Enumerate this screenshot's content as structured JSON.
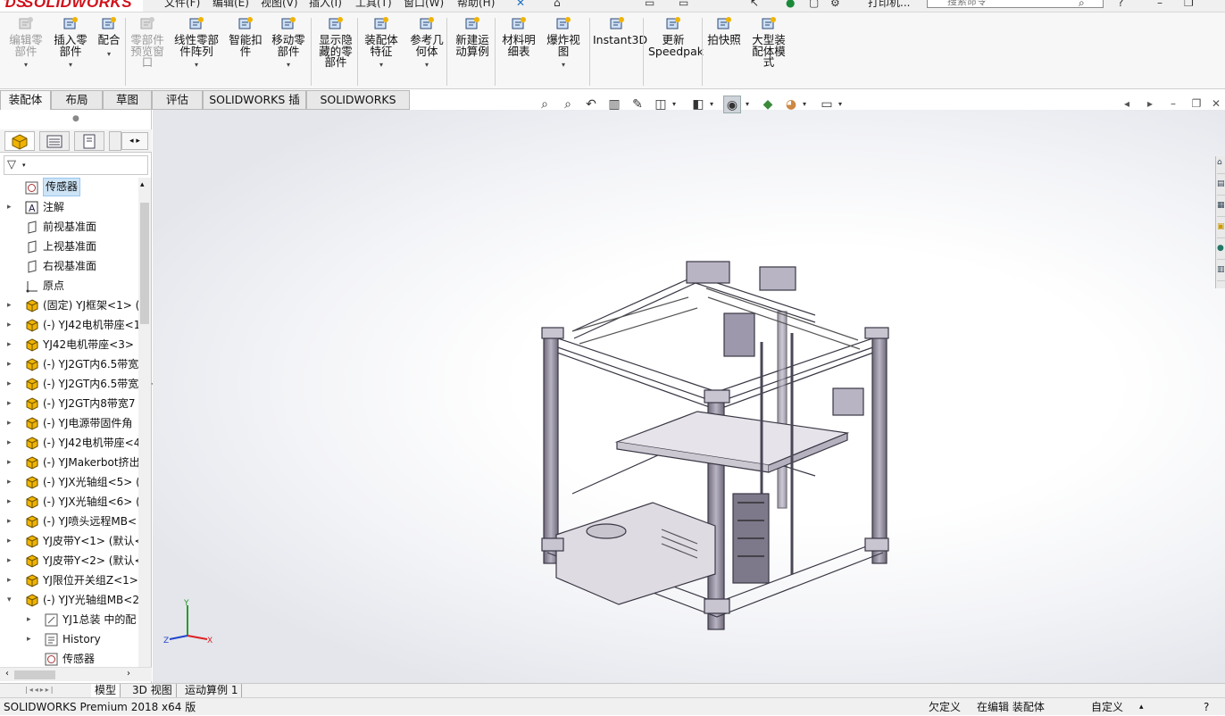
{
  "app": {
    "logo": "SOLIDWORKS",
    "menus": [
      "文件(F)",
      "编辑(E)",
      "视图(V)",
      "插入(I)",
      "工具(T)",
      "窗口(W)",
      "帮助(H)"
    ],
    "doc_title": "打印机...",
    "search_placeholder": "搜索命令"
  },
  "ribbon": {
    "buttons": [
      {
        "label": "编辑零\n部件",
        "icon": "edit-component-icon",
        "disabled": true
      },
      {
        "label": "插入零\n部件",
        "icon": "insert-component-icon",
        "disabled": false
      },
      {
        "label": "配合",
        "icon": "mate-icon",
        "disabled": false
      },
      {
        "label": "零部件\n预览窗\n口",
        "icon": "component-preview-icon",
        "disabled": true
      },
      {
        "label": "线性零部\n件阵列",
        "icon": "linear-pattern-icon",
        "disabled": false
      },
      {
        "label": "智能扣\n件",
        "icon": "smart-fasteners-icon",
        "disabled": false
      },
      {
        "label": "移动零\n部件",
        "icon": "move-component-icon",
        "disabled": false
      },
      {
        "label": "显示隐\n藏的零\n部件",
        "icon": "show-hidden-icon",
        "disabled": false
      },
      {
        "label": "装配体\n特征",
        "icon": "assembly-features-icon",
        "disabled": false
      },
      {
        "label": "参考几\n何体",
        "icon": "reference-geometry-icon",
        "disabled": false
      },
      {
        "label": "新建运\n动算例",
        "icon": "new-motion-study-icon",
        "disabled": false
      },
      {
        "label": "材料明\n细表",
        "icon": "bill-of-materials-icon",
        "disabled": false
      },
      {
        "label": "爆炸视\n图",
        "icon": "exploded-view-icon",
        "disabled": false
      },
      {
        "label": "Instant3D",
        "icon": "instant3d-icon",
        "disabled": false
      },
      {
        "label": "更新\nSpeedpak",
        "icon": "update-speedpak-icon",
        "disabled": false
      },
      {
        "label": "拍快照",
        "icon": "snapshot-icon",
        "disabled": false
      },
      {
        "label": "大型装\n配体模\n式",
        "icon": "large-assembly-mode-icon",
        "disabled": false
      }
    ]
  },
  "command_tabs": [
    "装配体",
    "布局",
    "草图",
    "评估",
    "SOLIDWORKS 插件",
    "SOLIDWORKS MBD"
  ],
  "feature_tree": {
    "items": [
      {
        "label": "传感器",
        "icon": "sensor-icon",
        "expand": "",
        "depth": 0,
        "selected": true
      },
      {
        "label": "注解",
        "icon": "annotation-icon",
        "expand": "▸",
        "depth": 0
      },
      {
        "label": "前视基准面",
        "icon": "plane-icon",
        "expand": "",
        "depth": 0
      },
      {
        "label": "上视基准面",
        "icon": "plane-icon",
        "expand": "",
        "depth": 0
      },
      {
        "label": "右视基准面",
        "icon": "plane-icon",
        "expand": "",
        "depth": 0
      },
      {
        "label": "原点",
        "icon": "origin-icon",
        "expand": "",
        "depth": 0
      },
      {
        "label": "(固定) YJ框架<1> (",
        "icon": "part-icon",
        "expand": "▸",
        "depth": 0
      },
      {
        "label": "(-) YJ42电机带座<1",
        "icon": "part-icon",
        "expand": "▸",
        "depth": 0
      },
      {
        "label": "YJ42电机带座<3>",
        "icon": "part-icon",
        "expand": "▸",
        "depth": 0
      },
      {
        "label": "(-) YJ2GT内6.5带宽",
        "icon": "part-icon",
        "expand": "▸",
        "depth": 0
      },
      {
        "label": "(-) YJ2GT内6.5带宽",
        "icon": "part-icon",
        "expand": "▸",
        "depth": 0
      },
      {
        "label": "(-) YJ2GT内8带宽7",
        "icon": "part-icon",
        "expand": "▸",
        "depth": 0
      },
      {
        "label": "(-) YJ电源带固件角",
        "icon": "part-icon",
        "expand": "▸",
        "depth": 0
      },
      {
        "label": "(-) YJ42电机带座<4",
        "icon": "part-icon",
        "expand": "▸",
        "depth": 0
      },
      {
        "label": "(-) YJMakerbot挤出",
        "icon": "part-icon",
        "expand": "▸",
        "depth": 0
      },
      {
        "label": "(-) YJX光轴组<5> (",
        "icon": "part-icon",
        "expand": "▸",
        "depth": 0
      },
      {
        "label": "(-) YJX光轴组<6> (",
        "icon": "part-icon",
        "expand": "▸",
        "depth": 0
      },
      {
        "label": "(-) YJ喷头远程MB<",
        "icon": "part-icon",
        "expand": "▸",
        "depth": 0
      },
      {
        "label": "YJ皮带Y<1> (默认<",
        "icon": "part-icon",
        "expand": "▸",
        "depth": 0
      },
      {
        "label": "YJ皮带Y<2> (默认<",
        "icon": "part-icon",
        "expand": "▸",
        "depth": 0
      },
      {
        "label": "YJ限位开关组Z<1>",
        "icon": "part-icon",
        "expand": "▸",
        "depth": 0
      },
      {
        "label": "(-) YJY光轴组MB<2",
        "icon": "part-icon",
        "expand": "▾",
        "depth": 0
      },
      {
        "label": "YJ1总装 中的配",
        "icon": "mates-folder-icon",
        "expand": "▸",
        "depth": 1
      },
      {
        "label": "History",
        "icon": "history-icon",
        "expand": "▸",
        "depth": 1
      },
      {
        "label": "传感器",
        "icon": "sensor-icon",
        "expand": "",
        "depth": 1
      }
    ]
  },
  "bottom_tabs": [
    "模型",
    "3D 视图",
    "运动算例 1"
  ],
  "status": {
    "left": "SOLIDWORKS Premium 2018 x64 版",
    "undefined": "欠定义",
    "editing": "在编辑 装配体",
    "custom": "自定义"
  },
  "triad": {
    "x": "X",
    "y": "Y",
    "z": "Z"
  },
  "colors": {
    "brand": "#d0121b",
    "part_icon": "#f0b400",
    "model": "#8a8594"
  }
}
